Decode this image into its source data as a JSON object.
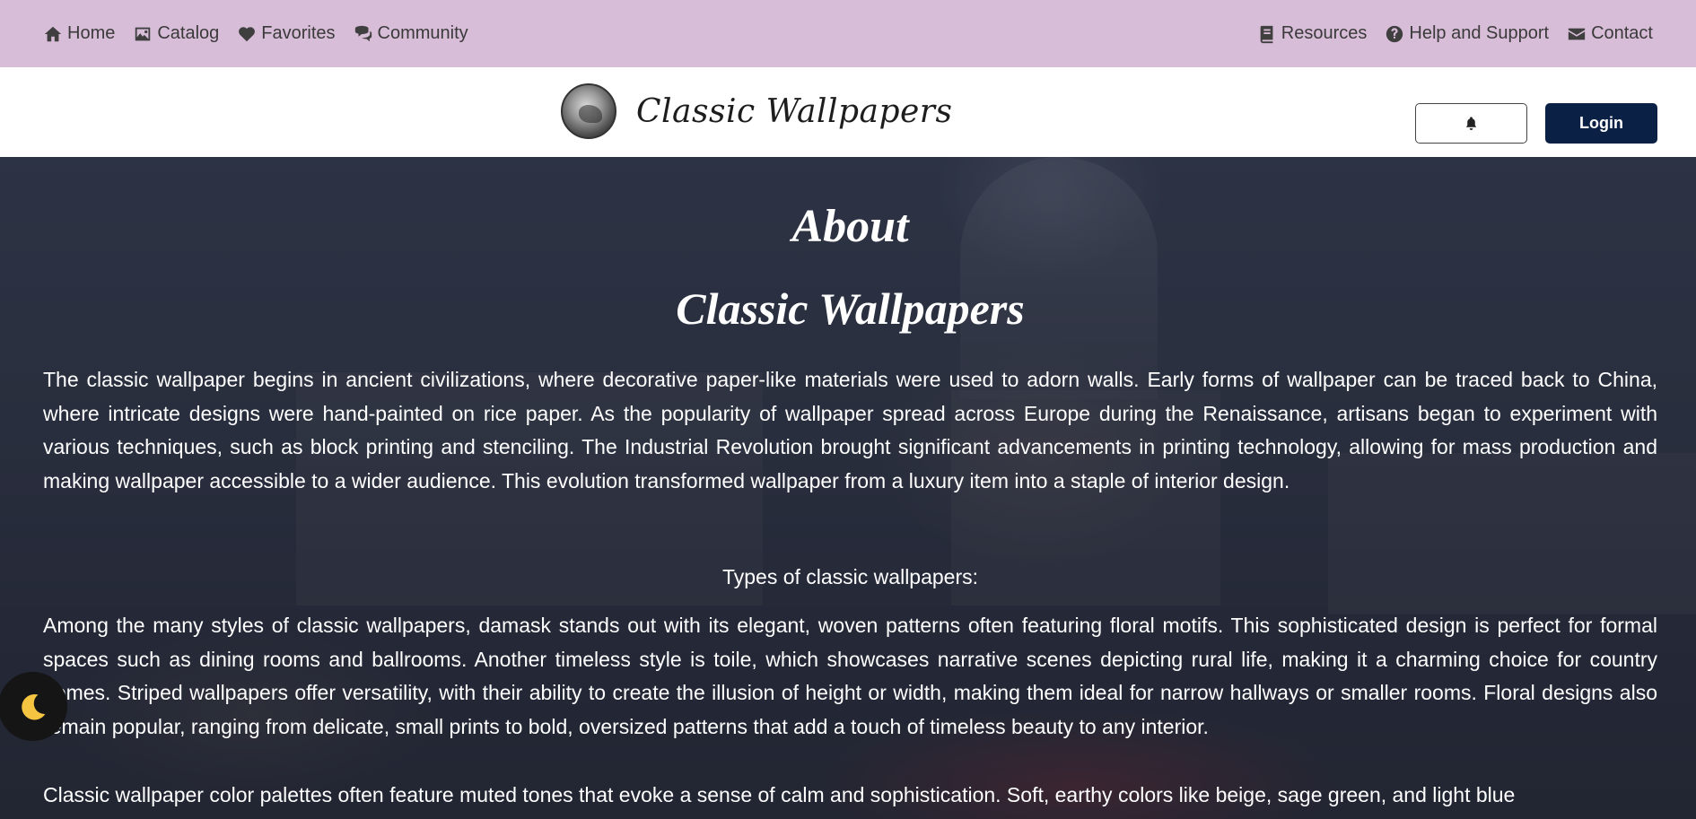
{
  "topnav": {
    "left": [
      {
        "label": "Home",
        "icon": "home-icon"
      },
      {
        "label": "Catalog",
        "icon": "image-icon"
      },
      {
        "label": "Favorites",
        "icon": "heart-icon"
      },
      {
        "label": "Community",
        "icon": "comments-icon"
      }
    ],
    "right": [
      {
        "label": "Resources",
        "icon": "book-icon"
      },
      {
        "label": "Help and Support",
        "icon": "question-circle-icon"
      },
      {
        "label": "Contact",
        "icon": "envelope-icon"
      }
    ]
  },
  "header": {
    "brand_name": "Classic Wallpapers",
    "notification_icon": "bell-icon",
    "login_label": "Login",
    "login_bg": "#0b2045",
    "nav_bg": "#d8bdd8"
  },
  "main": {
    "heading_about": "About",
    "heading_title": "Classic Wallpapers",
    "paragraph_1": "The classic wallpaper begins in ancient civilizations, where decorative paper-like materials were used to adorn walls. Early forms of wallpaper can be traced back to China, where intricate designs were hand-painted on rice paper. As the popularity of wallpaper spread across Europe during the Renaissance, artisans began to experiment with various techniques, such as block printing and stenciling. The Industrial Revolution brought significant advancements in printing technology, allowing for mass production and making wallpaper accessible to a wider audience. This evolution transformed wallpaper from a luxury item into a staple of interior design.",
    "subheading": "Types of classic wallpapers:",
    "paragraph_2": "Among the many styles of classic wallpapers, damask stands out with its elegant, woven patterns often featuring floral motifs. This sophisticated design is perfect for formal spaces such as dining rooms and ballrooms. Another timeless style is toile, which showcases narrative scenes depicting rural life, making it a charming choice for country homes. Striped wallpapers offer versatility, with their ability to create the illusion of height or width, making them ideal for narrow hallways or smaller rooms. Floral designs also remain popular, ranging from delicate, small prints to bold, oversized patterns that add a touch of timeless beauty to any interior.",
    "paragraph_3": "Classic wallpaper color palettes often feature muted tones that evoke a sense of calm and sophistication. Soft, earthy colors like beige, sage green, and light blue"
  },
  "theme_toggle": {
    "icon": "moon-icon"
  }
}
